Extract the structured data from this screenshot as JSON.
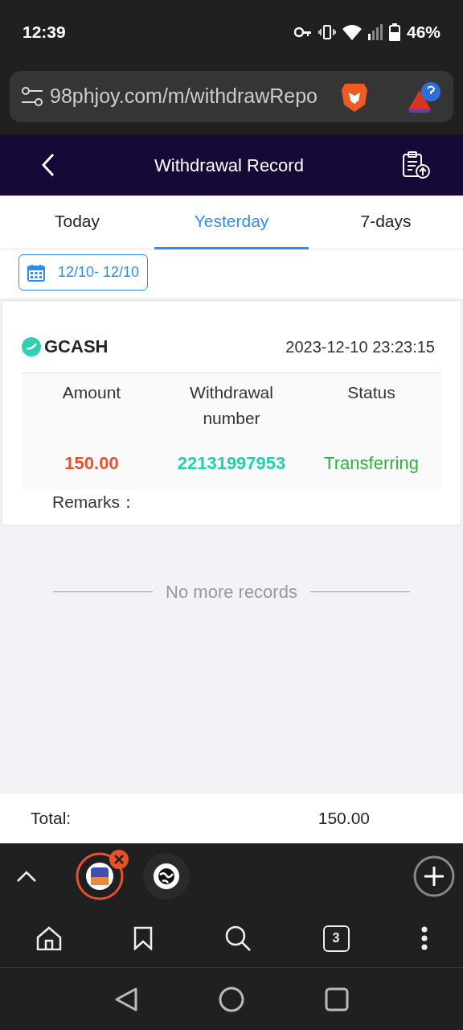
{
  "status_bar": {
    "time": "12:39",
    "battery": "46%"
  },
  "address_bar": {
    "url": "98phjoy.com/m/withdrawRepo"
  },
  "header": {
    "title": "Withdrawal Record"
  },
  "tabs": [
    {
      "label": "Today",
      "selected": false
    },
    {
      "label": "Yesterday",
      "selected": true
    },
    {
      "label": "7-days",
      "selected": false
    }
  ],
  "date_range": "12/10- 12/10",
  "records": [
    {
      "method": "GCASH",
      "datetime": "2023-12-10 23:23:15",
      "columns": [
        "Amount",
        "Withdrawal number",
        "Status"
      ],
      "amount": "150.00",
      "number": "22131997953",
      "status": "Transferring",
      "remarks": "Remarks："
    }
  ],
  "end_note": "No more records",
  "total": {
    "label": "Total:",
    "value": "150.00"
  },
  "browser_toolbar": {
    "tab_count": "3"
  }
}
